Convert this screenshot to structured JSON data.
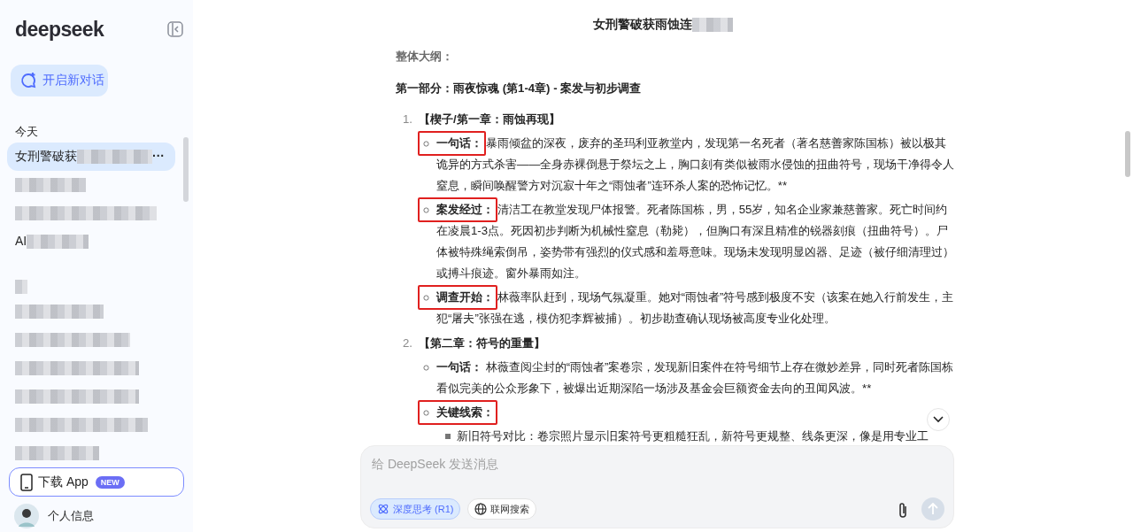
{
  "sidebar": {
    "logo": "deepseek",
    "new_chat": "开启新对话",
    "groups": [
      {
        "label": "今天",
        "redacted_label": false,
        "items": [
          {
            "text": "女刑警破获",
            "redacted": true,
            "selected": true,
            "more": "···"
          },
          {
            "redacted": true,
            "selected": false
          },
          {
            "redacted": true,
            "selected": false
          },
          {
            "text": "AI",
            "redacted": true,
            "selected": false
          }
        ]
      },
      {
        "redacted_label": true,
        "items": [
          {
            "redacted": true,
            "selected": false
          },
          {
            "redacted": true,
            "selected": false
          },
          {
            "redacted": true,
            "selected": false
          },
          {
            "redacted": true,
            "selected": false
          },
          {
            "redacted": true,
            "selected": false
          },
          {
            "redacted": true,
            "selected": false
          }
        ]
      }
    ],
    "download": {
      "label": "下载 App",
      "badge": "NEW"
    },
    "user": {
      "name": "个人信息"
    }
  },
  "chat": {
    "title": "女刑警破获雨蚀连",
    "title_redacted": true,
    "heading": "整体大纲：",
    "part": "第一部分：雨夜惊魂 (第1-4章) - 案发与初步调查",
    "chapters": [
      {
        "number": "1.",
        "title": "【楔子/第一章：雨蚀再现】",
        "points": [
          {
            "label": "一句话：",
            "highlighted": true,
            "text": "暴雨倾盆的深夜，废弃的圣玛利亚教堂内，发现第一名死者（著名慈善家陈国栋）被以极其诡异的方式杀害——全身赤裸倒悬于祭坛之上，胸口刻有类似被雨水侵蚀的扭曲符号，现场干净得令人窒息，瞬间唤醒警方对沉寂十年之“雨蚀者”连环杀人案的恐怖记忆。**"
          },
          {
            "label": "案发经过：",
            "highlighted": true,
            "text": "清洁工在教堂发现尸体报警。死者陈国栋，男，55岁，知名企业家兼慈善家。死亡时间约在凌晨1-3点。死因初步判断为机械性窒息（勒毙），但胸口有深且精准的锐器刻痕（扭曲符号）。尸体被特殊绳索倒吊，姿势带有强烈的仪式感和羞辱意味。现场未发现明显凶器、足迹（被仔细清理过）或搏斗痕迹。窗外暴雨如注。"
          },
          {
            "label": "调查开始：",
            "highlighted": true,
            "text": "林薇率队赶到，现场气氛凝重。她对“雨蚀者”符号感到极度不安（该案在她入行前发生，主犯“屠夫”张强在逃，模仿犯李辉被捕）。初步勘查确认现场被高度专业化处理。"
          }
        ]
      },
      {
        "number": "2.",
        "title": "【第二章：符号的重量】",
        "points": [
          {
            "label": "一句话：",
            "highlighted": false,
            "text": "林薇查阅尘封的“雨蚀者”案卷宗，发现新旧案件在符号细节上存在微妙差异，同时死者陈国栋看似完美的公众形象下，被爆出近期深陷一场涉及基金会巨额资金去向的丑闻风波。**"
          },
          {
            "label": "关键线索：",
            "highlighted": true,
            "subpoints": [
              "新旧符号对比：卷宗照片显示旧案符号更粗糙狂乱，新符号更规整、线条更深，像是用专业工"
            ]
          }
        ]
      }
    ]
  },
  "composer": {
    "placeholder": "给 DeepSeek 发送消息",
    "deep_think": {
      "label": "深度思考 (R1)",
      "selected": true
    },
    "web_search": {
      "label": "联网搜索",
      "selected": false
    }
  }
}
